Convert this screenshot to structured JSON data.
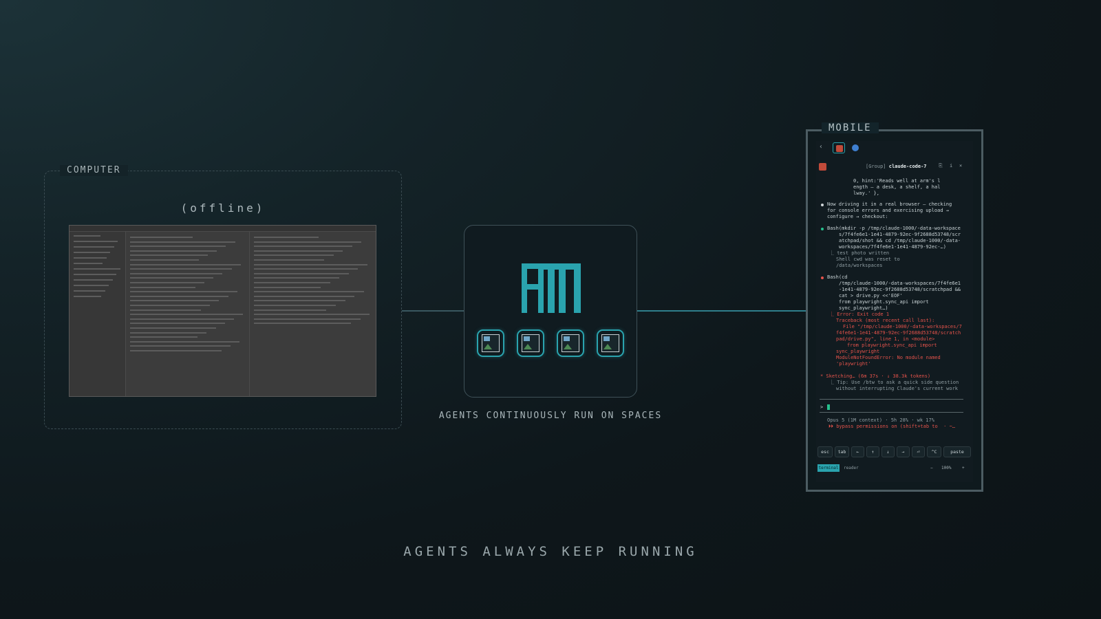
{
  "computer": {
    "label": "COMPUTER",
    "status": "(offline)"
  },
  "hub": {
    "logo_icon": "atl-logo-icon",
    "agents": [
      "image-icon",
      "image-icon",
      "image-icon",
      "image-icon"
    ],
    "caption": "AGENTS CONTINUOUSLY RUN ON SPACES"
  },
  "footer": {
    "caption": "AGENTS ALWAYS KEEP RUNNING"
  },
  "mobile": {
    "label": "MOBILE",
    "header": {
      "group": "[Group]",
      "title": "claude-code-7"
    },
    "transcript": [
      "0, hint:'Reads well at arm's l",
      "ength — a desk, a shelf, a hal",
      "lway.' },",
      "Now driving it in a real browser — checking",
      "for console errors and exercising upload →",
      "configure → checkout:",
      "Bash(mkdir -p /tmp/claude-1000/-data-workspace",
      "s/7f4fe6e1-1e41-4879-92ec-9f2688d53748/scr",
      "atchpad/shot && cd /tmp/claude-1000/-data-",
      "workspaces/7f4fe6e1-1e41-4879-92ec-…)",
      "⎿ test photo written",
      "Shell cwd was reset to",
      "/data/workspaces",
      "Bash(cd",
      "/tmp/claude-1000/-data-workspaces/7f4fe6e1",
      "-1e41-4879-92ec-9f2688d53748/scratchpad &&",
      "cat > drive.py <<'EOF'",
      "from playwright.sync_api import",
      "sync_playwright…)",
      "⎿ Error: Exit code 1",
      "Traceback (most recent call last):",
      "File \"/tmp/claude-1000/-data-workspaces/7",
      "f4fe6e1-1e41-4879-92ec-9f2688d53748/scratch",
      "pad/drive.py\", line 1, in <module>",
      "from playwright.sync_api import",
      "sync_playwright",
      "ModuleNotFoundError: No module named",
      "'playwright'",
      "* Sketching… (6m 37s · ↓ 38.3k tokens)",
      "⎿ Tip: Use /btw to ask a quick side question",
      "without interrupting Claude's current work",
      "Opus 5 (1M context) · 5h 28% · wk 17%",
      "⏵⏵ bypass permissions on (shift+tab to  · ~…"
    ],
    "prompt_symbol": ">",
    "keys": [
      "esc",
      "tab",
      "←",
      "↑",
      "↓",
      "→",
      "⏎",
      "^C",
      "paste"
    ],
    "modes": {
      "terminal": "terminal",
      "reader": "reader"
    },
    "zoom": {
      "minus": "−",
      "value": "100%",
      "plus": "+"
    },
    "colors": {
      "accent": "#2aa3ae",
      "error": "#e5534b",
      "success": "#26c08d"
    }
  }
}
